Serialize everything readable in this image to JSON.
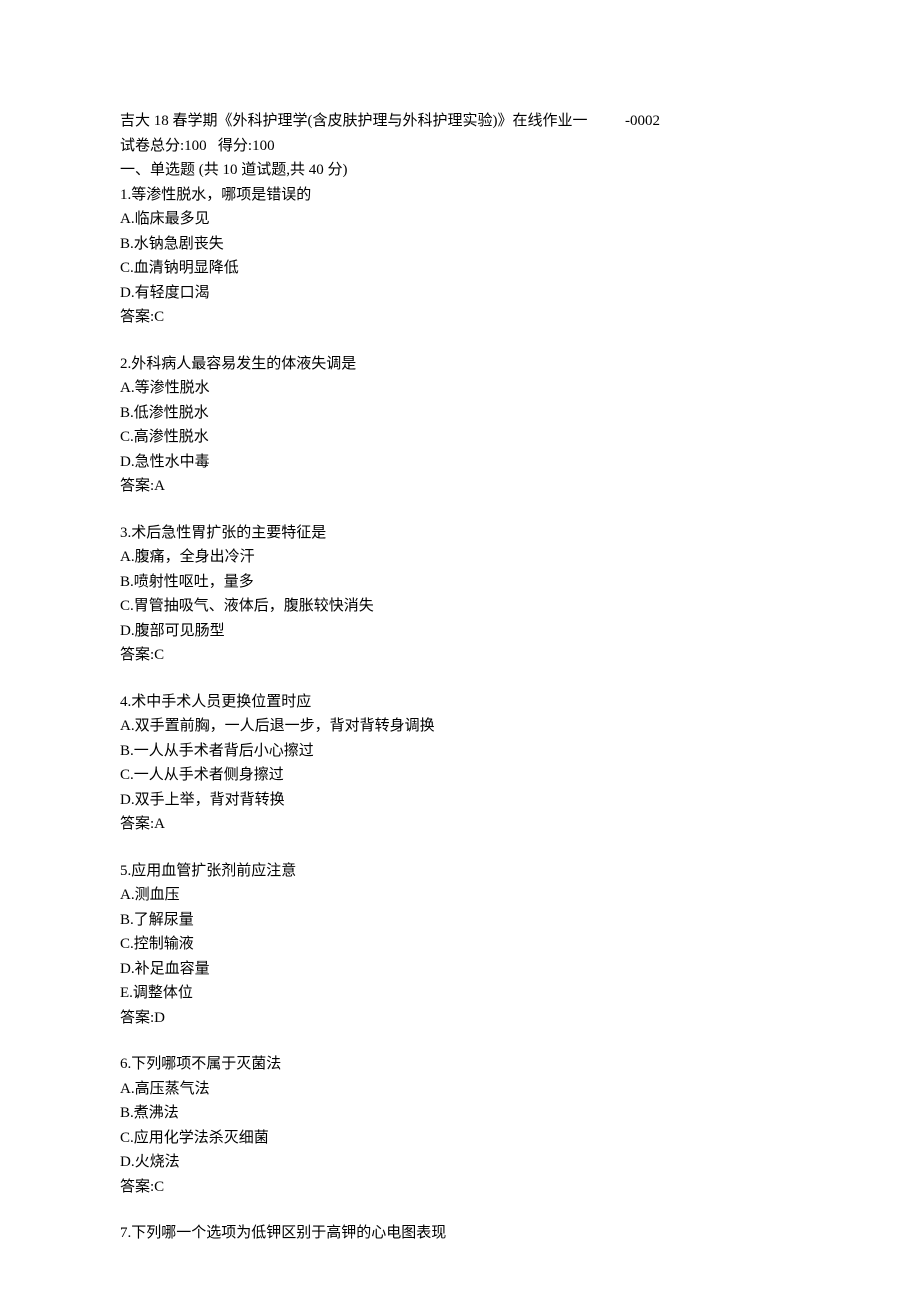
{
  "header": {
    "title": "吉大 18 春学期《外科护理学(含皮肤护理与外科护理实验)》在线作业一",
    "code": "-0002"
  },
  "meta": {
    "total_label": "试卷总分:",
    "total_value": "100",
    "score_label": "得分:",
    "score_value": "100"
  },
  "section": {
    "title": "一、单选题  (共  10  道试题,共  40  分)"
  },
  "questions": [
    {
      "number": "1.",
      "text": "等渗性脱水，哪项是错误的",
      "options": [
        "A.临床最多见",
        "B.水钠急剧丧失",
        "C.血清钠明显降低",
        "D.有轻度口渴"
      ],
      "answer_label": "答案:",
      "answer": "C"
    },
    {
      "number": "2.",
      "text": "外科病人最容易发生的体液失调是",
      "options": [
        "A.等渗性脱水",
        "B.低渗性脱水",
        "C.高渗性脱水",
        "D.急性水中毒"
      ],
      "answer_label": "答案:",
      "answer": "A"
    },
    {
      "number": "3.",
      "text": "术后急性胃扩张的主要特征是",
      "options": [
        "A.腹痛，全身出冷汗",
        "B.喷射性呕吐，量多",
        "C.胃管抽吸气、液体后，腹胀较快消失",
        "D.腹部可见肠型"
      ],
      "answer_label": "答案:",
      "answer": "C"
    },
    {
      "number": "4.",
      "text": "术中手术人员更换位置时应",
      "options": [
        "A.双手置前胸，一人后退一步，背对背转身调换",
        "B.一人从手术者背后小心擦过",
        "C.一人从手术者侧身擦过",
        "D.双手上举，背对背转换"
      ],
      "answer_label": "答案:",
      "answer": "A"
    },
    {
      "number": "5.",
      "text": "应用血管扩张剂前应注意",
      "options": [
        "A.测血压",
        "B.了解尿量",
        "C.控制输液",
        "D.补足血容量",
        "E.调整体位"
      ],
      "answer_label": "答案:",
      "answer": "D"
    },
    {
      "number": "6.",
      "text": "下列哪项不属于灭菌法",
      "options": [
        "A.高压蒸气法",
        "B.煮沸法",
        "C.应用化学法杀灭细菌",
        "D.火烧法"
      ],
      "answer_label": "答案:",
      "answer": "C"
    },
    {
      "number": "7.",
      "text": "下列哪一个选项为低钾区别于高钾的心电图表现",
      "options": [],
      "answer_label": "",
      "answer": ""
    }
  ]
}
